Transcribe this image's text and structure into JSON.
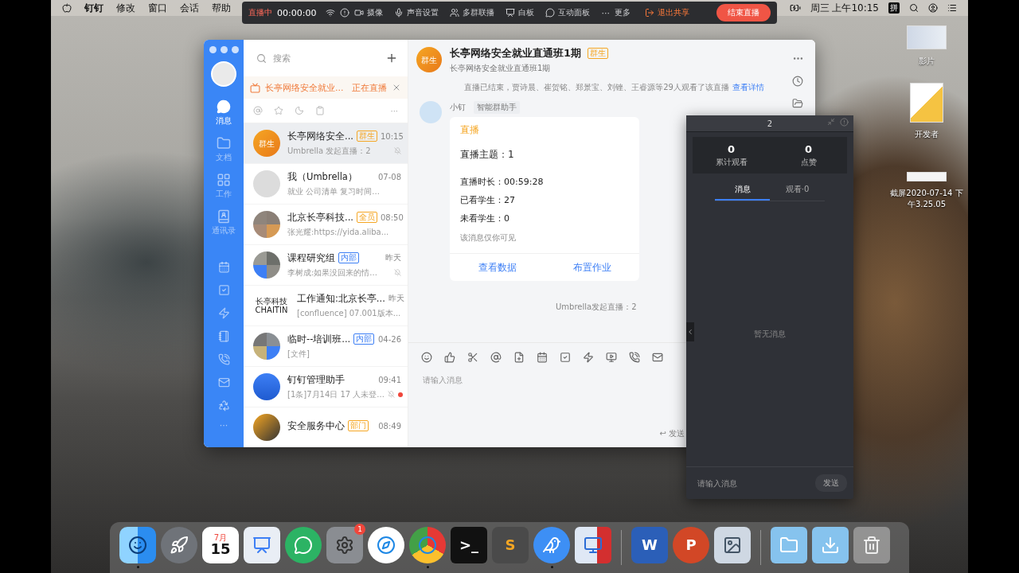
{
  "menubar": {
    "app": "钉钉",
    "menus": [
      "修改",
      "窗口",
      "会话",
      "帮助"
    ],
    "input_method": "拼",
    "clock": "周三 上午10:15"
  },
  "live_toolbar": {
    "status": "直播中",
    "timer": "00:00:00",
    "items": [
      {
        "label": "摄像"
      },
      {
        "label": "声音设置"
      },
      {
        "label": "多群联播"
      },
      {
        "label": "白板"
      },
      {
        "label": "互动面板"
      }
    ],
    "more_glyph": "···",
    "more": "更多",
    "exit": "退出共享",
    "end": "结束直播"
  },
  "sidebar": {
    "items": [
      {
        "label": "消息",
        "selected": true
      },
      {
        "label": "文档",
        "selected": false
      },
      {
        "label": "工作",
        "selected": false
      },
      {
        "label": "通讯录",
        "selected": false
      }
    ],
    "more": "···"
  },
  "chat_list": {
    "search": {
      "placeholder": "搜索"
    },
    "live_banner": {
      "title": "长亭网络安全就业...",
      "status": "正在直播"
    },
    "filter_more": "···",
    "rows": [
      {
        "avatar_text": "群生",
        "name": "长亭网络安全...",
        "tag": "群生",
        "color": "#f5a623",
        "time": "10:15",
        "preview": "Umbrella 发起直播：2",
        "selected": true,
        "muted": true,
        "unread": false
      },
      {
        "name": "我（Umbrella）",
        "time": "07-08",
        "preview": "就业  公司清单  复习时间...",
        "selected": false,
        "muted": false,
        "unread": false
      },
      {
        "name": "北京长亭科技...",
        "tag": "全员",
        "color": "#f5a623",
        "time": "08:50",
        "preview": "张光耀:https://yida.aliba...",
        "selected": false,
        "muted": false,
        "unread": false
      },
      {
        "name": "课程研究组",
        "tag": "内部",
        "color": "#3d7ff5",
        "time": "昨天",
        "preview": "李树成:如果没回来的情...",
        "selected": false,
        "muted": true,
        "unread": false
      },
      {
        "avatar_text": "长亭科技",
        "avatar_subtext": "CHAITIN",
        "name": "工作通知:北京长亭...",
        "time": "昨天",
        "preview": "[confluence] 07.001版本...",
        "selected": false,
        "muted": false,
        "unread": false
      },
      {
        "name": "临时--培训班...",
        "tag": "内部",
        "color": "#3d7ff5",
        "time": "04-26",
        "preview": "[文件]",
        "selected": false,
        "muted": false,
        "unread": false
      },
      {
        "name": "钉钉管理助手",
        "time": "09:41",
        "preview": "[1条]7月14日 17 人未登...",
        "selected": false,
        "muted": true,
        "unread": true
      },
      {
        "name": "安全服务中心",
        "tag": "部门",
        "color": "#f5a623",
        "time": "08:49",
        "selected": false,
        "muted": false,
        "unread": false
      }
    ]
  },
  "chat": {
    "header": {
      "avatar_text": "群生",
      "title": "长亭网络安全就业直通班1期",
      "tag": "群生",
      "subtitle": "长亭网络安全就业直通班1期"
    },
    "notice": {
      "text": "直播已结束，贾诗晨、崔贺铭、郑景宝、刘锉、王睿源等29人观看了该直播",
      "link": "查看详情"
    },
    "message": {
      "sender": "小钉",
      "badge": "智能群助手",
      "card": {
        "title": "直播",
        "topic": "直播主题：1",
        "lines": [
          "直播时长：00:59:28",
          "已看学生：27",
          "未看学生：0"
        ],
        "note": "该消息仅你可见",
        "actions": [
          "查看数据",
          "布置作业"
        ]
      }
    },
    "event": "Umbrella发起直播：2",
    "composer": {
      "placeholder": "请输入消息",
      "send": "↩ 发送"
    }
  },
  "live_panel": {
    "title": "2",
    "stats": [
      {
        "value": "0",
        "label": "累计观看"
      },
      {
        "value": "0",
        "label": "点赞"
      }
    ],
    "tabs": [
      {
        "label": "消息",
        "selected": true
      },
      {
        "label": "观看·0",
        "selected": false
      }
    ],
    "empty": "暂无消息",
    "input": {
      "placeholder": "请输入消息"
    },
    "send": "发送"
  },
  "desktop_icons": [
    {
      "label": "影片"
    },
    {
      "label": "开发者"
    },
    {
      "label": "截屏2020-07-14 下午3.25.05"
    }
  ],
  "dock": {
    "items": [
      {
        "running": true
      },
      {
        "running": false
      },
      {
        "caption": "7月",
        "text": "15",
        "running": false
      },
      {
        "running": false
      },
      {
        "running": false
      },
      {
        "badge": "1",
        "running": false
      },
      {
        "running": false
      },
      {
        "running": true
      },
      {
        "text": ">_",
        "running": false
      },
      {
        "text": "S",
        "running": false
      },
      {
        "running": true
      },
      {
        "running": false
      },
      {
        "text": "W",
        "running": false
      },
      {
        "text": "P",
        "running": false
      },
      {
        "running": false
      },
      {
        "running": false
      },
      {
        "running": false
      },
      {
        "running": false
      }
    ]
  }
}
